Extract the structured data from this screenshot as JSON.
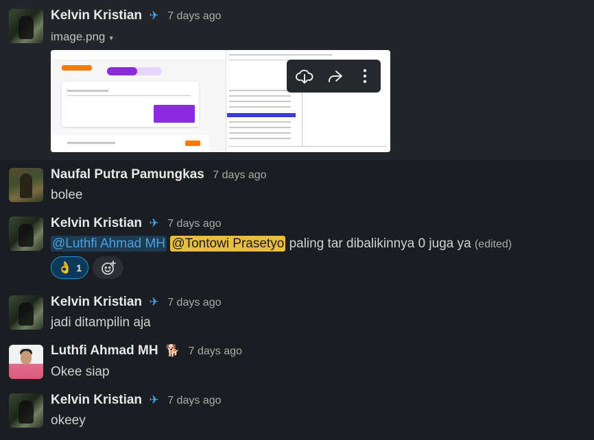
{
  "messages": [
    {
      "author": "Kelvin Kristian",
      "status_emoji": "✈",
      "time": "7 days ago",
      "file_name": "image.png",
      "file_caret": "▾"
    },
    {
      "author": "Naufal Putra Pamungkas",
      "time": "7 days ago",
      "text": "bolee"
    },
    {
      "author": "Kelvin Kristian",
      "status_emoji": "✈",
      "time": "7 days ago",
      "mention1": "@Luthfi Ahmad MH",
      "mention2": "@Tontowi Prasetyo",
      "text": "paling tar dibalikinnya 0 juga ya",
      "edited": "(edited)",
      "reaction_emoji": "👌",
      "reaction_count": "1",
      "add_reaction_icon": "☺"
    },
    {
      "author": "Kelvin Kristian",
      "status_emoji": "✈",
      "time": "7 days ago",
      "text": "jadi ditampilin aja"
    },
    {
      "author": "Luthfi Ahmad MH",
      "status_emoji": "🐕",
      "time": "7 days ago",
      "text": "Okee siap"
    },
    {
      "author": "Kelvin Kristian",
      "status_emoji": "✈",
      "time": "7 days ago",
      "text": "okeey"
    }
  ],
  "colors": {
    "background": "#1a1d21",
    "mention_blue": "#4aa3df",
    "mention_yellow": "#f2c744",
    "reaction_border": "#1d9bd1"
  },
  "icons": {
    "download": "download-cloud-icon",
    "share": "share-arrow-icon",
    "more": "more-vertical-icon"
  }
}
